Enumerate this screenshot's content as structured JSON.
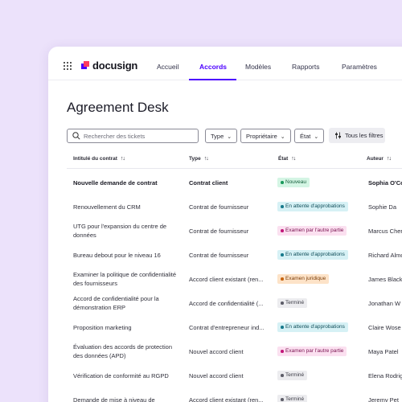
{
  "app": {
    "logo_text": "docusign"
  },
  "nav": [
    {
      "label": "Accueil",
      "active": false
    },
    {
      "label": "Accords",
      "active": true
    },
    {
      "label": "Modèles",
      "active": false
    },
    {
      "label": "Rapports",
      "active": false
    },
    {
      "label": "Paramètres",
      "active": false
    }
  ],
  "page": {
    "title": "Agreement Desk"
  },
  "search": {
    "placeholder": "Rechercher des tickets"
  },
  "filters": {
    "type": "Type",
    "owner": "Propriétaire",
    "state": "État",
    "all": "Tous les filtres"
  },
  "table": {
    "columns": [
      "Intitulé du contrat",
      "Type",
      "État",
      "Auteur"
    ],
    "rows": [
      {
        "title": "Nouvelle demande de contrat",
        "type": "Contrat client",
        "status": "Nouveau",
        "status_kind": "green",
        "author": "Sophia O'Co"
      },
      {
        "title": "Renouvellement du CRM",
        "type": "Contrat de fournisseur",
        "status": "En attente d'approbations",
        "status_kind": "teal",
        "author": "Sophie Da"
      },
      {
        "title": "UTG pour l'expansion du centre de données",
        "type": "Contrat de fournisseur",
        "status": "Examen par l'autre partie",
        "status_kind": "pink",
        "author": "Marcus Cher"
      },
      {
        "title": "Bureau debout pour le niveau 16",
        "type": "Contrat de fournisseur",
        "status": "En attente d'approbations",
        "status_kind": "teal",
        "author": "Richard Almo"
      },
      {
        "title": "Examiner la politique de confidentialité des fournisseurs",
        "type": "Accord client existant (ren...",
        "status": "Examen juridique",
        "status_kind": "orange",
        "author": "James Black"
      },
      {
        "title": "Accord de confidentialité pour la démonstration ERP",
        "type": "Accord de confidentialité (...",
        "status": "Terminé",
        "status_kind": "grey",
        "author": "Jonathan W"
      },
      {
        "title": "Proposition marketing",
        "type": "Contrat d'entrepreneur ind...",
        "status": "En attente d'approbations",
        "status_kind": "teal",
        "author": "Claire Wose"
      },
      {
        "title": "Évaluation des accords de protection des données (APD)",
        "type": "Nouvel accord client",
        "status": "Examen par l'autre partie",
        "status_kind": "pink",
        "author": "Maya Patel"
      },
      {
        "title": "Vérification de conformité au RGPD",
        "type": "Nouvel accord client",
        "status": "Terminé",
        "status_kind": "grey",
        "author": "Elena Rodrig"
      },
      {
        "title": "Demande de mise à niveau de",
        "type": "Accord client existant (ren...",
        "status": "Terminé",
        "status_kind": "grey",
        "author": "Jeremy Pet"
      }
    ]
  },
  "status_colors": {
    "green": {
      "bg": "#d4f5e4",
      "dot": "#1a9a5c",
      "text": "#135c3a"
    },
    "teal": {
      "bg": "#d6f1f5",
      "dot": "#177a8c",
      "text": "#0f4d59"
    },
    "pink": {
      "bg": "#fbe0f0",
      "dot": "#c2187a",
      "text": "#7a1250"
    },
    "orange": {
      "bg": "#fde3c8",
      "dot": "#c76512",
      "text": "#7a3c08"
    },
    "grey": {
      "bg": "#ececef",
      "dot": "#5d5d68",
      "text": "#3b3b45"
    }
  },
  "colors": {
    "accent": "#4c00ff",
    "background": "#ece2fb"
  }
}
